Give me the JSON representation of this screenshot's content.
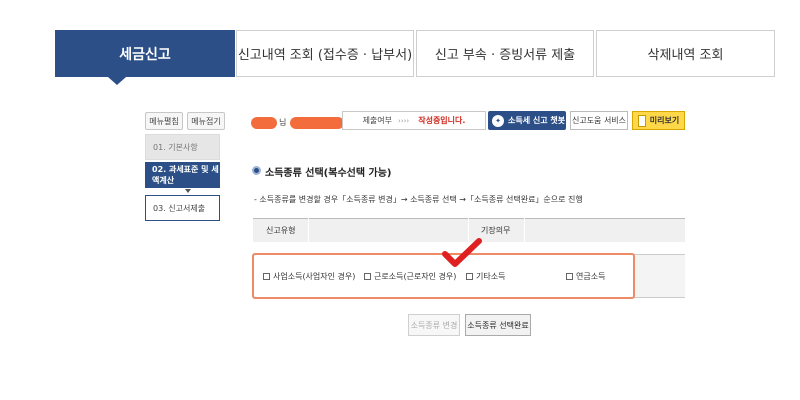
{
  "tabs": [
    {
      "label": "세금신고",
      "active": true
    },
    {
      "label": "신고내역 조회 (접수증 · 납부서)",
      "active": false
    },
    {
      "label": "신고 부속 · 증빙서류 제출",
      "active": false
    },
    {
      "label": "삭제내역 조회",
      "active": false
    }
  ],
  "menu": {
    "expand_label": "메뉴펼침",
    "collapse_label": "메뉴접기",
    "items": [
      {
        "label": "01. 기본사항"
      },
      {
        "label": "02. 과세표준 및 세액계산"
      },
      {
        "label": "03. 신고서제출"
      }
    ]
  },
  "header": {
    "name_suffix": "님",
    "status_label": "제출여부",
    "status_arrows": "››››",
    "status_value": "작성중입니다.",
    "income_types_button": "소득세 신고 챗봇",
    "help_service_button": "신고도움 서비스",
    "preview_button": "미리보기"
  },
  "section": {
    "title": "소득종류 선택(복수선택 가능)",
    "note": "- 소득종류를 변경할 경우「소득종류 변경」→ 소득종류 선택 →「소득종류 선택완료」순으로 진행"
  },
  "table": {
    "col_type": "신고유형",
    "col_duty": "기장의무"
  },
  "checkboxes": [
    {
      "label": "사업소득(사업자인 경우)",
      "checked": false
    },
    {
      "label": "근로소득(근로자인 경우)",
      "checked": false
    },
    {
      "label": "기타소득",
      "checked": false
    },
    {
      "label": "연금소득",
      "checked": false
    }
  ],
  "buttons": {
    "change_label": "소득종류 변경",
    "complete_label": "소득종류 선택완료"
  },
  "colors": {
    "primary": "#2b4f86",
    "highlight": "#ee8a66",
    "check_mark": "#e02020",
    "redaction": "#f26d3b"
  }
}
